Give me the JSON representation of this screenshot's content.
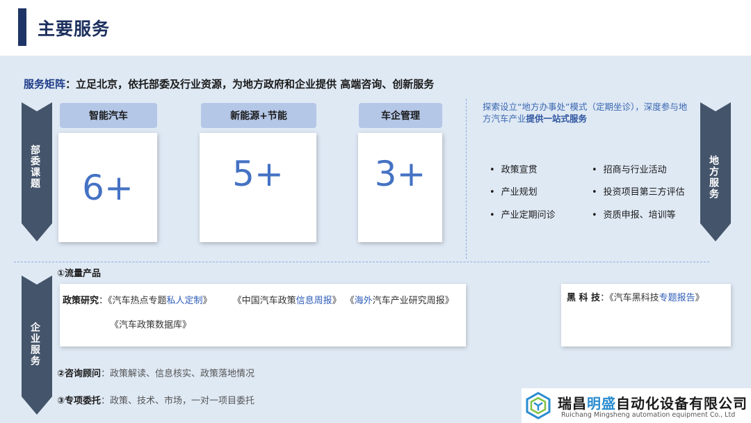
{
  "header": {
    "title": "主要服务"
  },
  "matrix": {
    "label": "服务矩阵",
    "text": "：立足北京，依托部委及行业资源，为地方政府和企业提供  高端咨询、创新服务"
  },
  "ministry_arrow": "部委课题",
  "local_arrow": "地方服务",
  "enterprise_arrow": "企业服务",
  "topics": [
    {
      "tab": "智能汽车",
      "value": "6+"
    },
    {
      "tab": "新能源+节能",
      "value": "5+"
    },
    {
      "tab": "车企管理",
      "value": "3+"
    }
  ],
  "local_service": {
    "desc_plain": "探索设立“地方办事处”模式（定期坐诊），深度参与地方汽车产业",
    "desc_bold": "提供一站式服务",
    "items_left": [
      "政策宣贯",
      "产业规划",
      "产业定期问诊"
    ],
    "items_right": [
      "招商与行业活动",
      "投资项目第三方评估",
      "资质申报、培训等"
    ]
  },
  "enterprise": {
    "traffic_title": "①流量产品",
    "policy_label": "政策研究",
    "policy_sep": "：",
    "p1_a": "《汽车热点专题",
    "p1_hl": "私人定制",
    "p1_b": "》",
    "p2_a": "《中国汽车政策",
    "p2_hl": "信息周报",
    "p2_b": "》",
    "p3_a": "《",
    "p3_hl": "海外",
    "p3_b": "汽车产业研究周报》",
    "p4": "《汽车政策数据库》",
    "tech_label": "黑 科 技",
    "tech_sep": "：",
    "t1_a": "《汽车黑科技",
    "t1_hl": "专题报告",
    "t1_b": "》",
    "consult_title": "②咨询顾问",
    "consult_text": "：政策解读、信息核实、政策落地情况",
    "special_title": "③专项委托",
    "special_text": "：政策、技术、市场，一对一项目委托"
  },
  "logo": {
    "name_a": "瑞昌",
    "name_accent": "明盛",
    "name_b": "自动化设备有限公司",
    "sub": "Ruichang Mingsheng automation equipment Co., Ltd"
  },
  "colors": {
    "navy": "#1f3466",
    "arrow": "#44546a",
    "tab": "#b4c7e7",
    "number": "#4472c4",
    "background": "#dfe9f4",
    "highlight": "#2e5cb8"
  }
}
